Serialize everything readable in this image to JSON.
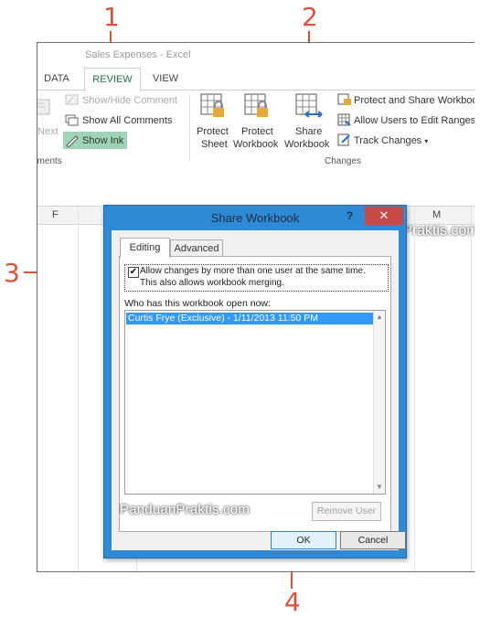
{
  "callouts": {
    "c1": "1",
    "c2": "2",
    "c3": "3",
    "c4": "4"
  },
  "excel": {
    "title": "Sales Expenses - Excel",
    "tabs": {
      "data": "DATA",
      "review": "REVIEW",
      "view": "VIEW"
    },
    "ribbon": {
      "next": "Next",
      "show_hide_comment": "Show/Hide Comment",
      "show_all_comments": "Show All Comments",
      "show_ink": "Show Ink",
      "comments_group": "nments",
      "protect_sheet": [
        "Protect",
        "Sheet"
      ],
      "protect_workbook": [
        "Protect",
        "Workbook"
      ],
      "share_workbook": [
        "Share",
        "Workbook"
      ],
      "protect_and_share": "Protect and Share Workbook",
      "allow_users": "Allow Users to Edit Ranges",
      "track_changes": "Track Changes",
      "changes_group": "Changes"
    },
    "columns": {
      "f": "F",
      "m": "M"
    },
    "watermark": "PanduanPraktis.com"
  },
  "dialog": {
    "title": "Share Workbook",
    "help": "?",
    "close": "✕",
    "tabs": {
      "editing": "Editing",
      "advanced": "Advanced"
    },
    "checkbox_line1": "Allow changes by more than one user at the same time.",
    "checkbox_line2": "This also allows workbook merging.",
    "checkbox_checked": true,
    "who_label": "Who has this workbook open now:",
    "users": [
      "Curtis Frye (Exclusive) - 1/11/2013 11:50 PM"
    ],
    "watermark": "PanduanPraktis.com",
    "remove_user": "Remove User",
    "ok": "OK",
    "cancel": "Cancel"
  },
  "colors": {
    "accent": "#217346",
    "callout": "#d9533a",
    "dialog_frame": "#2e8ad4",
    "close": "#c74b43",
    "selection": "#3399ff"
  }
}
